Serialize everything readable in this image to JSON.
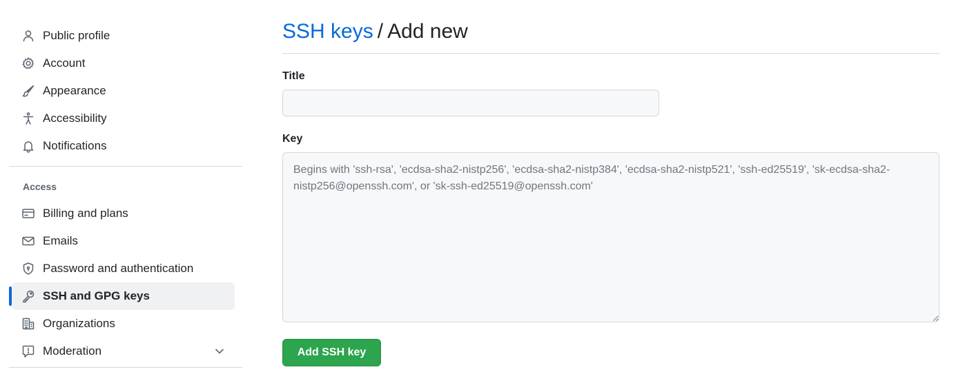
{
  "sidebar": {
    "items_top": [
      {
        "label": "Public profile",
        "icon": "person-icon"
      },
      {
        "label": "Account",
        "icon": "gear-icon"
      },
      {
        "label": "Appearance",
        "icon": "paintbrush-icon"
      },
      {
        "label": "Accessibility",
        "icon": "accessibility-icon"
      },
      {
        "label": "Notifications",
        "icon": "bell-icon"
      }
    ],
    "section_label": "Access",
    "items_access": [
      {
        "label": "Billing and plans",
        "icon": "credit-card-icon"
      },
      {
        "label": "Emails",
        "icon": "mail-icon"
      },
      {
        "label": "Password and authentication",
        "icon": "shield-icon"
      },
      {
        "label": "SSH and GPG keys",
        "icon": "key-icon",
        "active": true
      },
      {
        "label": "Organizations",
        "icon": "organization-icon"
      },
      {
        "label": "Moderation",
        "icon": "report-icon"
      }
    ]
  },
  "header": {
    "breadcrumb_link": "SSH keys",
    "separator": "/",
    "title": "Add new"
  },
  "form": {
    "title_label": "Title",
    "title_value": "",
    "key_label": "Key",
    "key_placeholder": "Begins with 'ssh-rsa', 'ecdsa-sha2-nistp256', 'ecdsa-sha2-nistp384', 'ecdsa-sha2-nistp521', 'ssh-ed25519', 'sk-ecdsa-sha2-nistp256@openssh.com', or 'sk-ssh-ed25519@openssh.com'",
    "key_value": "",
    "submit_label": "Add SSH key"
  },
  "colors": {
    "accent": "#0969da",
    "button": "#2da44e",
    "active_bg": "#eff1f3"
  }
}
